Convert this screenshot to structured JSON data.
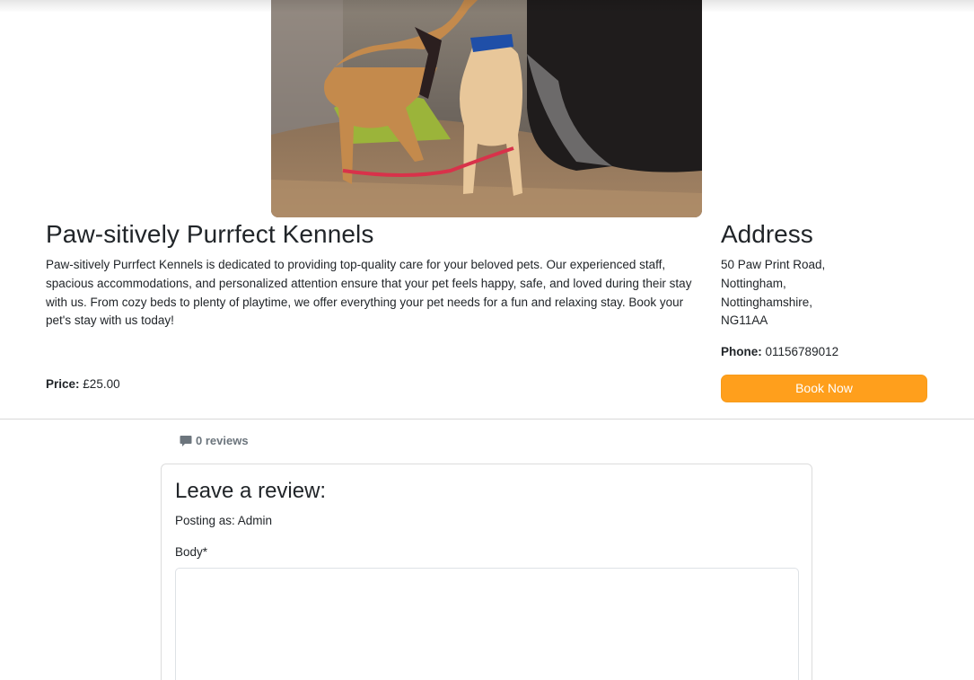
{
  "listing": {
    "title": "Paw-sitively Purrfect Kennels",
    "description": "Paw-sitively Purrfect Kennels is dedicated to providing top-quality care for your beloved pets. Our experienced staff, spacious accommodations, and personalized attention ensure that your pet feels happy, safe, and loved during their stay with us. From cozy beds to plenty of playtime, we offer everything your pet needs for a fun and relaxing stay. Book your pet's stay with us today!",
    "price_label": "Price:",
    "price_value": "£25.00"
  },
  "address": {
    "heading": "Address",
    "line1": "50 Paw Print Road,",
    "line2": "Nottingham,",
    "line3": "Nottinghamshire,",
    "line4": "NG11AA",
    "phone_label": "Phone:",
    "phone_value": "01156789012"
  },
  "actions": {
    "book_label": "Book Now"
  },
  "reviews": {
    "count_text": "0 reviews",
    "icon": "comment-icon"
  },
  "review_form": {
    "title": "Leave a review:",
    "posting_as": "Posting as: Admin",
    "body_label": "Body*",
    "body_value": ""
  },
  "colors": {
    "accent": "#ff9f1c",
    "muted": "#6c757d",
    "border": "#dcdcdc"
  }
}
